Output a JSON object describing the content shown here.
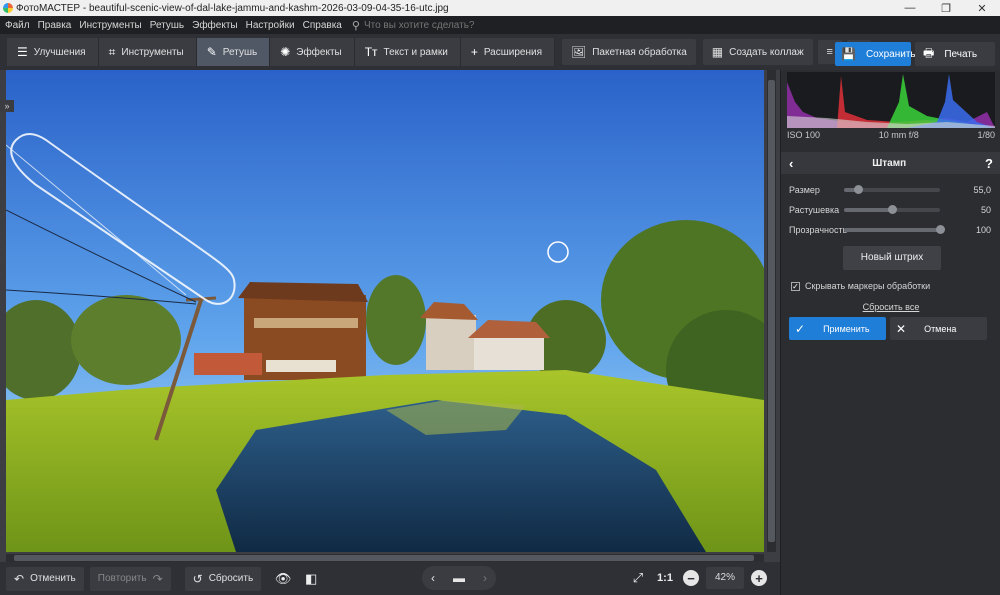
{
  "window": {
    "title": "ФотоМАСТЕР - beautiful-scenic-view-of-dal-lake-jammu-and-kashm-2026-03-09-04-35-16-utc.jpg",
    "minimize": "—",
    "maximize": "❐",
    "close": "✕"
  },
  "menu": {
    "items": [
      "Файл",
      "Правка",
      "Инструменты",
      "Ретушь",
      "Эффекты",
      "Настройки",
      "Справка"
    ],
    "search_placeholder": "Что вы хотите сделать?"
  },
  "toolbar": {
    "tabs": [
      {
        "label": "Улучшения",
        "icon": "sliders-icon",
        "glyph": "☰"
      },
      {
        "label": "Инструменты",
        "icon": "crop-icon",
        "glyph": "⌗"
      },
      {
        "label": "Ретушь",
        "icon": "brush-icon",
        "glyph": "✎"
      },
      {
        "label": "Эффекты",
        "icon": "sparkle-icon",
        "glyph": "✺"
      },
      {
        "label": "Текст и рамки",
        "icon": "text-icon",
        "glyph": "Tт"
      },
      {
        "label": "Расширения",
        "icon": "plus-icon",
        "glyph": "+"
      }
    ],
    "active_tab": "Ретушь",
    "batch_label": "Пакетная обработка",
    "collage_label": "Создать коллаж",
    "save_label": "Сохранить",
    "print_label": "Печать"
  },
  "exif": {
    "iso": "ISO 100",
    "lens": "10 mm f/8",
    "shutter": "1/80"
  },
  "panel": {
    "title": "Штамп",
    "back_icon": "‹",
    "help_icon": "?",
    "sliders": [
      {
        "label": "Размер",
        "value": "55,0",
        "fraction": 0.15
      },
      {
        "label": "Растушевка",
        "value": "50",
        "fraction": 0.5
      },
      {
        "label": "Прозрачность",
        "value": "100",
        "fraction": 1.0
      }
    ],
    "new_stroke_label": "Новый штрих",
    "hide_markers_label": "Скрывать маркеры обработки",
    "hide_markers_checked": true,
    "reset_all_label": "Сбросить все",
    "apply_label": "Применить",
    "cancel_label": "Отмена"
  },
  "bottom": {
    "undo_label": "Отменить",
    "redo_label": "Повторить",
    "reset_label": "Сбросить",
    "zoom_fit_label": "1:1",
    "zoom_value": "42%"
  },
  "colors": {
    "accent": "#1f7ed8",
    "panel_bg": "#2b2d31",
    "toolbar_bg": "#2e3035"
  }
}
